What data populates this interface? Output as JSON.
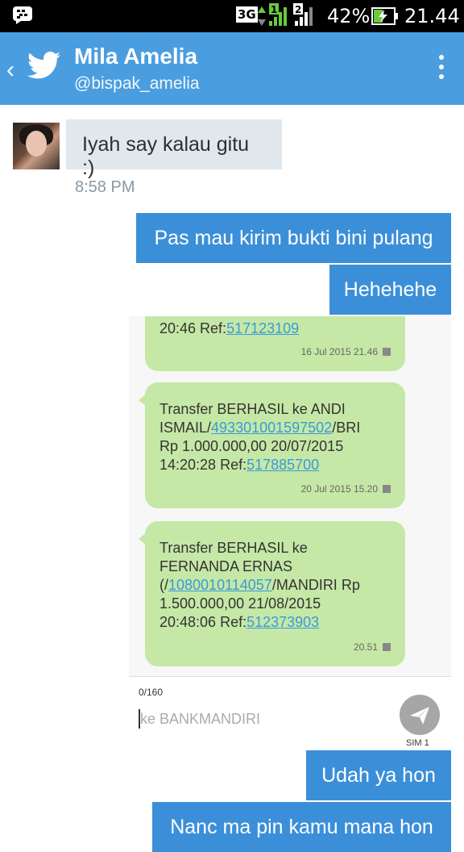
{
  "status_bar": {
    "network": "3G",
    "sim1": "1",
    "sim2": "2",
    "battery": "42%",
    "time": "21.44"
  },
  "header": {
    "name": "Mila Amelia",
    "handle": "@bispak_amelia"
  },
  "messages": {
    "incoming": {
      "text": "Iyah say kalau gitu :)",
      "time": "8:58 PM"
    },
    "outgoing": [
      "Pas mau kirim bukti bini pulang",
      "Hehehehe",
      "Udah ya hon",
      "Nanc ma pin kamu mana hon"
    ]
  },
  "screenshot": {
    "sms": [
      {
        "text": "20:46 Ref:",
        "link": "517123109",
        "stamp": "16 Jul 2015 21.46"
      },
      {
        "line1": "Transfer BERHASIL ke ANDI",
        "line2_prefix": "ISMAIL/",
        "line2_link": "493301001597502",
        "line2_suffix": "/BRI",
        "line3": "Rp 1.000.000,00 20/07/2015",
        "line4_prefix": "14:20:28 Ref:",
        "line4_link": "517885700",
        "stamp": "20 Jul 2015 15.20"
      },
      {
        "line1": "Transfer BERHASIL ke",
        "line2": "FERNANDA ERNAS",
        "line3_prefix": "(/",
        "line3_link": "1080010114057",
        "line3_suffix": "/MANDIRI Rp",
        "line4": "1.500.000,00 21/08/2015",
        "line5_prefix": "20:48:06 Ref:",
        "line5_link": "512373903",
        "stamp": "20.51"
      }
    ],
    "compose": {
      "counter": "0/160",
      "placeholder": "ke BANKMANDIRI",
      "sim_label": "SIM 1"
    }
  },
  "colors": {
    "header": "#4a9ee0",
    "outgoing_bubble": "#3b8fd9",
    "incoming_bubble": "#e1e8ed",
    "sms_bubble": "#c5e8a6"
  }
}
